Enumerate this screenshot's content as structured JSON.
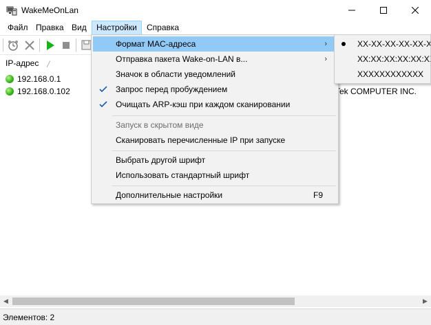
{
  "window": {
    "title": "WakeMeOnLan"
  },
  "menubar": {
    "items": [
      "Файл",
      "Правка",
      "Вид",
      "Настройки",
      "Справка"
    ]
  },
  "list": {
    "column_header": "IP-адрес",
    "rows": [
      {
        "ip": "192.168.0.1",
        "vendor": ""
      },
      {
        "ip": "192.168.0.102",
        "vendor": "Tek COMPUTER INC."
      }
    ]
  },
  "dropdown": {
    "items": [
      {
        "label": "Формат MAC-адреса",
        "submenu": true,
        "highlight": true
      },
      {
        "label": "Отправка пакета Wake-on-LAN в...",
        "submenu": true
      },
      {
        "label": "Значок в области уведомлений"
      },
      {
        "label": "Запрос перед пробуждением",
        "checked": true
      },
      {
        "label": "Очищать ARP-кэш при каждом сканировании",
        "checked": true
      },
      {
        "label": "Запуск в скрытом виде",
        "disabled": true
      },
      {
        "label": "Сканировать перечисленные IP при запуске"
      },
      {
        "label": "Выбрать другой шрифт"
      },
      {
        "label": "Использовать стандартный шрифт"
      },
      {
        "label": "Дополнительные настройки",
        "shortcut": "F9"
      }
    ]
  },
  "submenu": {
    "items": [
      {
        "label": "XX-XX-XX-XX-XX-XX",
        "selected": true
      },
      {
        "label": "XX:XX:XX:XX:XX:XX"
      },
      {
        "label": "XXXXXXXXXXXX"
      }
    ]
  },
  "statusbar": {
    "text": "Элементов: 2"
  },
  "colors": {
    "menu_highlight": "#91c9f7",
    "menu_active": "#cce8ff",
    "status_green": "#3cb51e"
  }
}
